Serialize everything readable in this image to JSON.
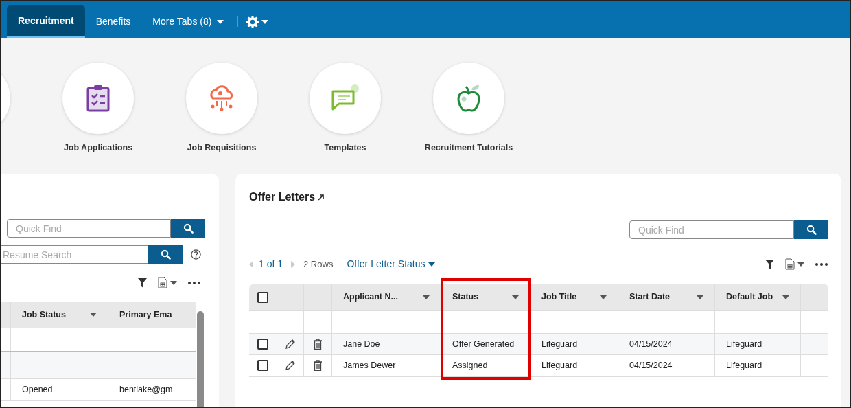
{
  "tabs": [
    {
      "label": "Recruitment",
      "selected": true
    },
    {
      "label": "Benefits",
      "selected": false
    },
    {
      "label": "More Tabs (8)",
      "selected": false,
      "kind": "dropdown"
    }
  ],
  "tiles": [
    {
      "kind": "partial"
    },
    {
      "label": "Job Applications",
      "kind": "clipboard"
    },
    {
      "label": "Job Requisitions",
      "kind": "cloud"
    },
    {
      "label": "Templates",
      "kind": "chat"
    },
    {
      "label": "Recruitment Tutorials",
      "kind": "apple"
    }
  ],
  "left_panel": {
    "quick_find": {
      "placeholder": "Quick Find"
    },
    "resume_search": {
      "placeholder": "Resume Search"
    },
    "table": {
      "columns": [
        "Job Status",
        "Primary Ema"
      ],
      "rows": [
        [
          "",
          ""
        ],
        [
          "Opened",
          "bentlake@gm"
        ]
      ]
    }
  },
  "offer_letters": {
    "title": "Offer Letters",
    "quick_find": {
      "placeholder": "Quick Find"
    },
    "pager": {
      "page": "1 of 1",
      "rows": "2 Rows",
      "view": "Offer Letter Status"
    },
    "table": {
      "select_all": {
        "checked": false
      },
      "columns": [
        {
          "label": "Applicant N...",
          "highlighted": false
        },
        {
          "label": "Status",
          "highlighted": true
        },
        {
          "label": "Job Title",
          "highlighted": false
        },
        {
          "label": "Start Date",
          "highlighted": false
        },
        {
          "label": "Default Job",
          "highlighted": false
        }
      ],
      "rows": [
        {
          "checked": false,
          "cells": [
            "Jane Doe",
            "Offer Generated",
            "Lifeguard",
            "04/15/2024",
            "Lifeguard"
          ]
        },
        {
          "checked": false,
          "cells": [
            "James Dewer",
            "Assigned",
            "Lifeguard",
            "04/15/2024",
            "Lifeguard"
          ]
        }
      ]
    }
  }
}
